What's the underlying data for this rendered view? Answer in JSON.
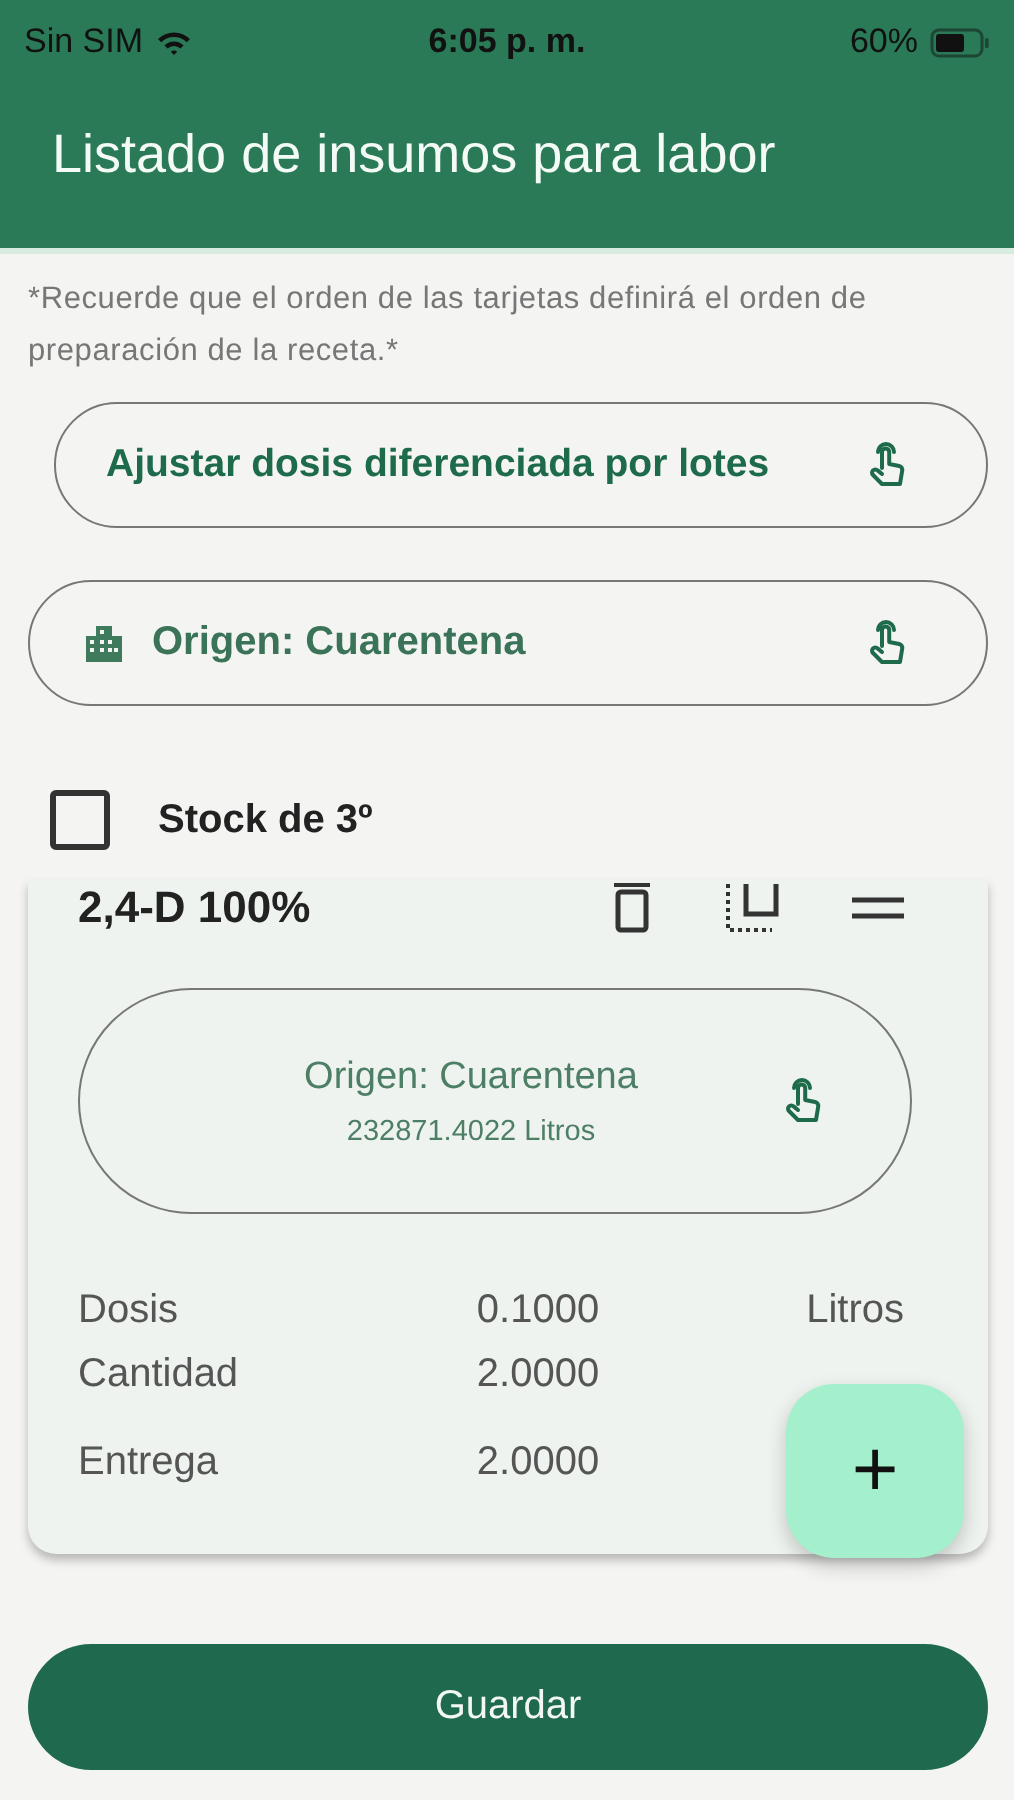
{
  "status_bar": {
    "carrier": "Sin SIM",
    "time": "6:05 p. m.",
    "battery": "60%"
  },
  "header": {
    "title": "Listado de insumos para labor"
  },
  "note": "*Recuerde que el orden de las tarjetas definirá el orden de preparación de la receta.*",
  "adjust_button": {
    "label": "Ajustar dosis diferenciada por lotes"
  },
  "origin_selector": {
    "label": "Origen: Cuarentena"
  },
  "third_party_stock": {
    "label": "Stock de 3º",
    "checked": false
  },
  "product_card": {
    "name": "2,4-D 100%",
    "origin": "Origen: Cuarentena",
    "stock": "232871.4022 Litros",
    "rows": [
      {
        "label": "Dosis",
        "value": "0.1000",
        "unit": "Litros"
      },
      {
        "label": "Cantidad",
        "value": "2.0000"
      },
      {
        "label": "Entrega",
        "value": "2.0000"
      }
    ]
  },
  "add_button": {
    "label": "+"
  },
  "save_button": {
    "label": "Guardar"
  }
}
